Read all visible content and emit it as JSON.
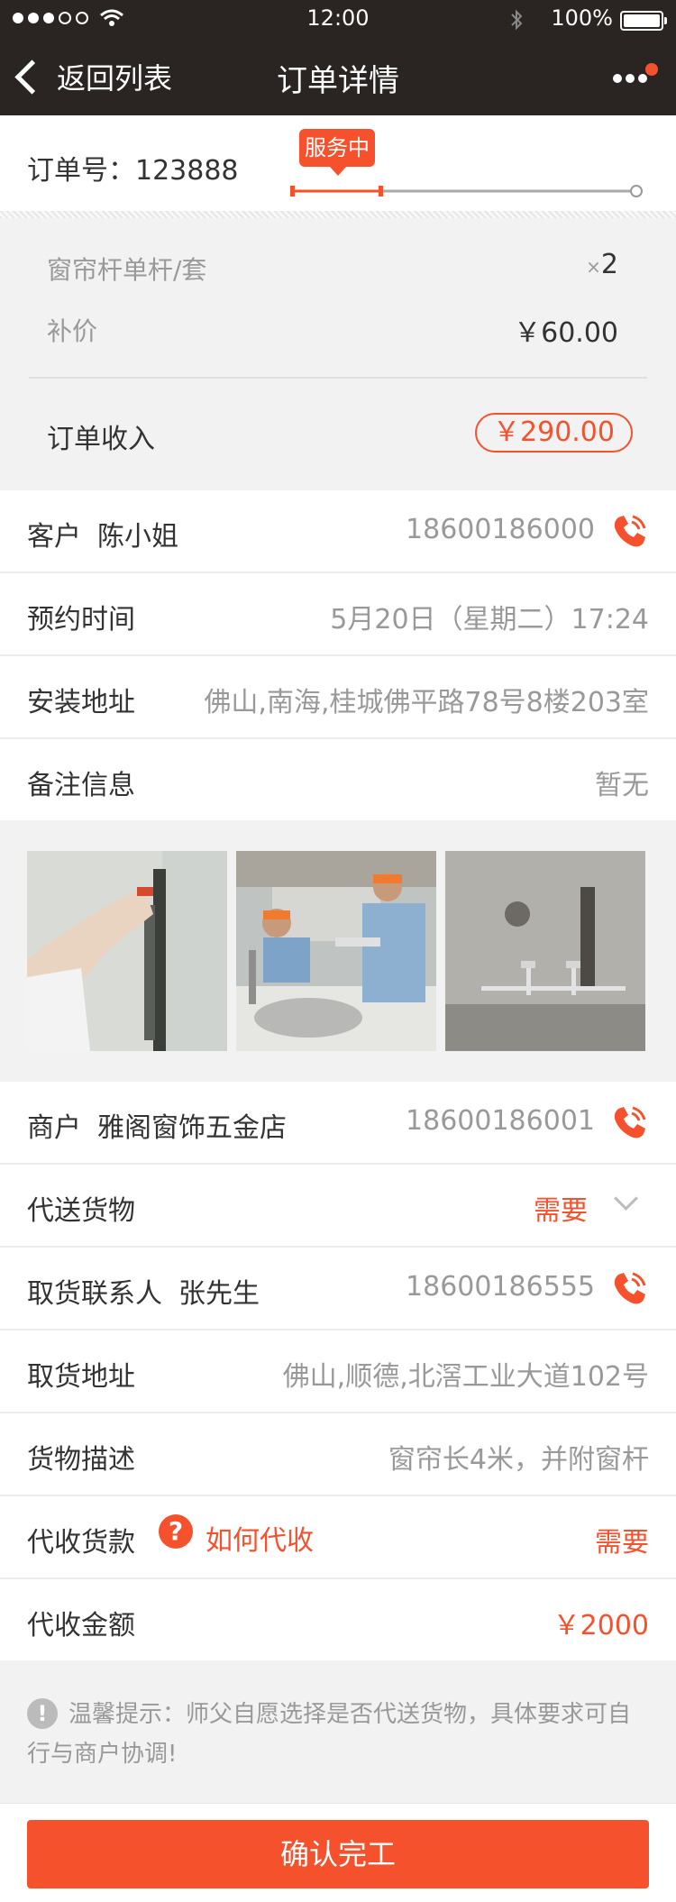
{
  "status_bar": {
    "time": "12:00",
    "battery_pct": "100%"
  },
  "nav": {
    "back_label": "返回列表",
    "title": "订单详情"
  },
  "order": {
    "number_label": "订单号：123888",
    "status_tip": "服务中"
  },
  "goods": {
    "item_name": "窗帘杆单杆/套",
    "item_qty_prefix": "×",
    "item_qty": "2",
    "supplement_label": "补价",
    "supplement_value": "￥60.00",
    "income_label": "订单收入",
    "income_value": "￥290.00"
  },
  "customer": {
    "label": "客户",
    "name": "陈小姐",
    "phone": "18600186000"
  },
  "appointment": {
    "label": "预约时间",
    "value": "5月20日（星期二）17:24"
  },
  "install_address": {
    "label": "安装地址",
    "value": "佛山,南海,桂城佛平路78号8楼203室"
  },
  "remarks": {
    "label": "备注信息",
    "value": "暂无"
  },
  "merchant": {
    "label": "商户",
    "name": "雅阁窗饰五金店",
    "phone": "18600186001"
  },
  "delivery": {
    "label": "代送货物",
    "value": "需要"
  },
  "pickup_contact": {
    "label": "取货联系人",
    "name": "张先生",
    "phone": "18600186555"
  },
  "pickup_address": {
    "label": "取货地址",
    "value": "佛山,顺德,北滘工业大道102号"
  },
  "goods_desc": {
    "label": "货物描述",
    "value": "窗帘长4米，并附窗杆"
  },
  "cod": {
    "label": "代收货款",
    "help_link": "如何代收",
    "value": "需要"
  },
  "cod_amount": {
    "label": "代收金额",
    "value": "￥2000"
  },
  "notice": {
    "text": "温馨提示：师父自愿选择是否代送货物，具体要求可自行与商户协调!"
  },
  "footer": {
    "confirm_label": "确认完工"
  },
  "colors": {
    "accent": "#f5512d",
    "header_bg": "#2a2522"
  }
}
